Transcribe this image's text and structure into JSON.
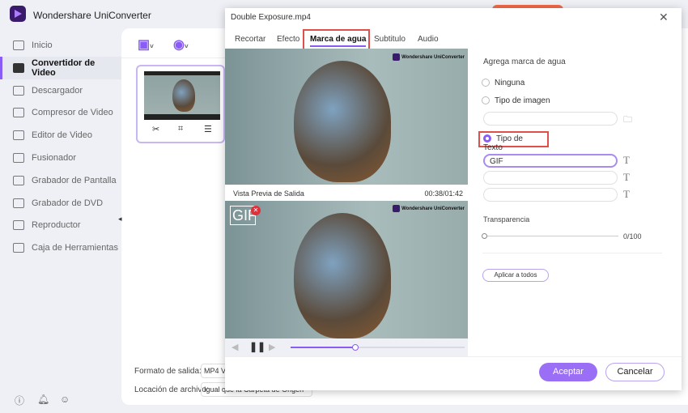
{
  "app": {
    "title": "Wondershare UniConverter"
  },
  "sidebar": {
    "items": [
      {
        "label": "Inicio",
        "icon": "home-icon"
      },
      {
        "label": "Convertidor de Video",
        "icon": "converter-icon",
        "active": true
      },
      {
        "label": "Descargador",
        "icon": "download-icon"
      },
      {
        "label": "Compresor de Video",
        "icon": "compress-icon"
      },
      {
        "label": "Editor de Video",
        "icon": "scissors-icon"
      },
      {
        "label": "Fusionador",
        "icon": "merge-icon"
      },
      {
        "label": "Grabador de Pantalla",
        "icon": "screen-record-icon"
      },
      {
        "label": "Grabador de DVD",
        "icon": "dvd-icon"
      },
      {
        "label": "Reproductor",
        "icon": "player-icon"
      },
      {
        "label": "Caja de Herramientas",
        "icon": "toolbox-icon"
      }
    ]
  },
  "bottom": {
    "format_label": "Formato de salida:",
    "format_value": "MP4 V",
    "location_label": "Locación de archivo:",
    "location_value": "Igual que la Carpeta de Origen"
  },
  "dialog": {
    "title": "Double Exposure.mp4",
    "tabs": [
      "Recortar",
      "Efecto",
      "Marca de agua",
      "Subtitulo",
      "Audio"
    ],
    "active_tab": "Marca de agua",
    "watermark_brand": "Wondershare UniConverter",
    "preview_label": "Vista Previa de Salida",
    "time": "00:38/01:42",
    "overlay_text": "GIF",
    "progress_percent": 37,
    "panel": {
      "heading": "Agrega marca de agua",
      "options": [
        "Ninguna",
        "Tipo de imagen",
        "Tipo de Texto"
      ],
      "selected": "Tipo de Texto",
      "text_inputs": [
        "GIF",
        "",
        ""
      ],
      "transparency_label": "Transparencia",
      "transparency_value": "0/100",
      "apply_all": "Aplicar a todos"
    },
    "ok": "Aceptar",
    "cancel": "Cancelar"
  },
  "colors": {
    "accent": "#8a5cf6",
    "highlight": "#e0504a"
  }
}
